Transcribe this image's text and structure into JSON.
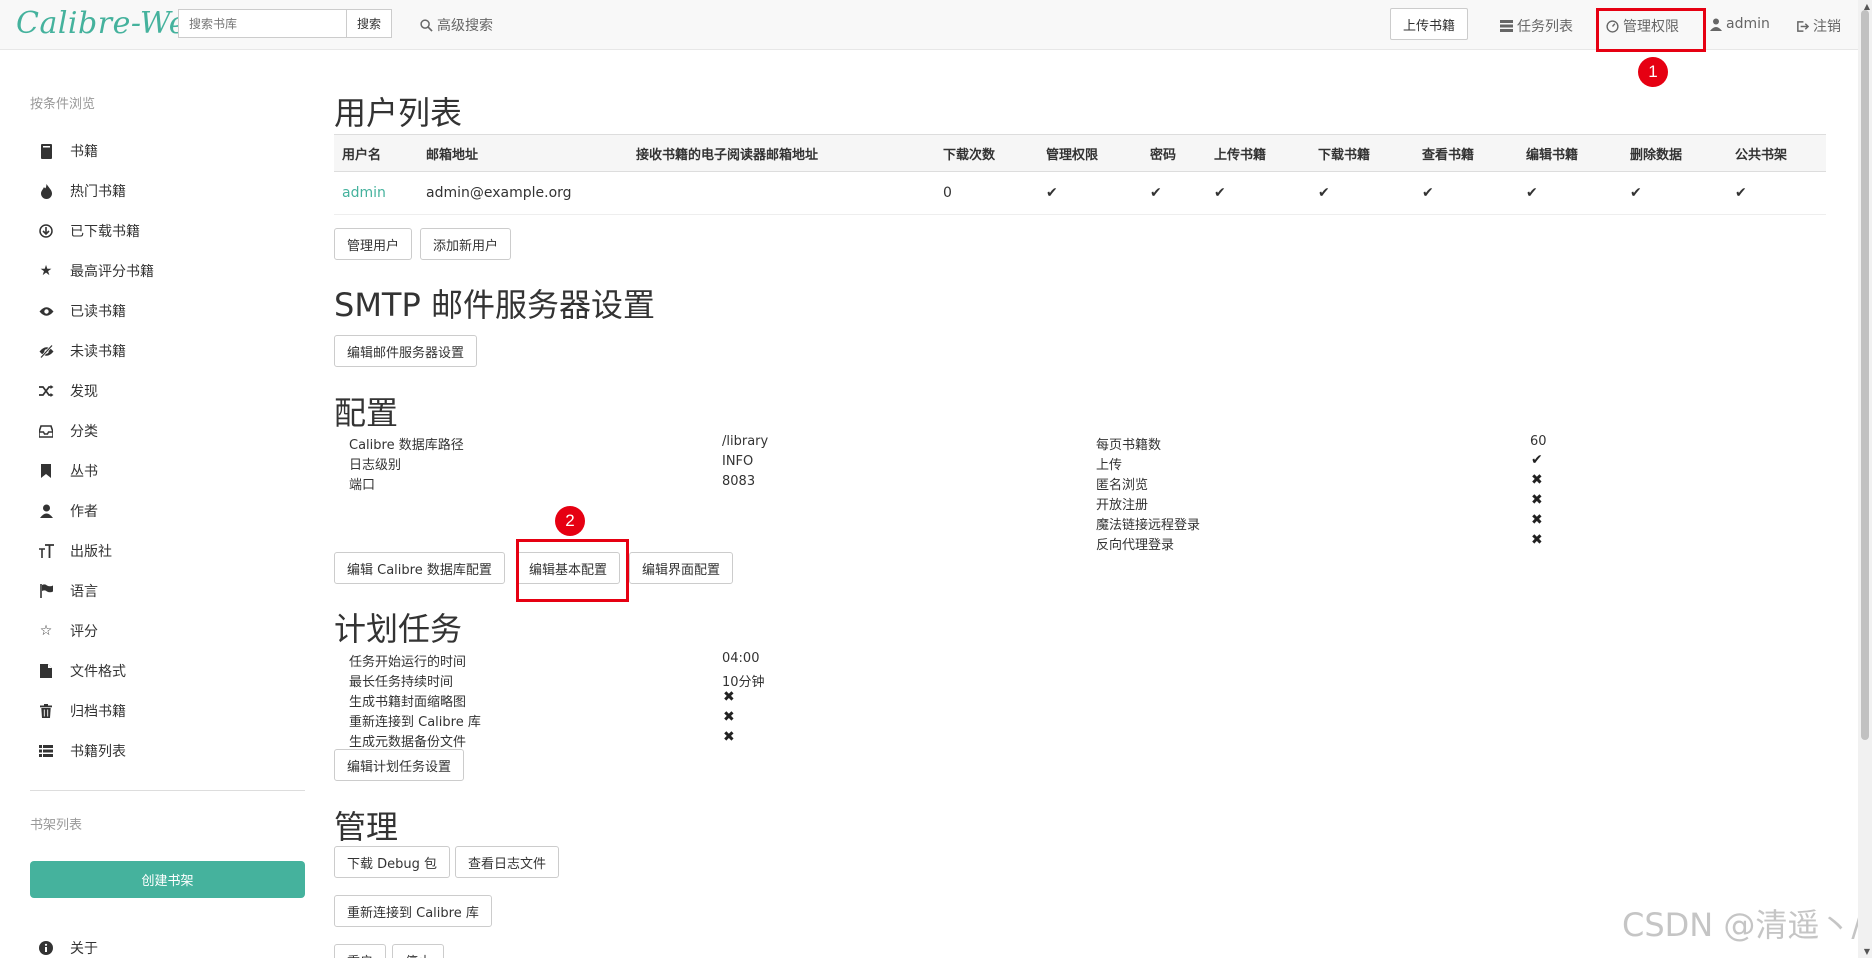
{
  "brand": "Calibre-Web",
  "search": {
    "placeholder": "搜索书库",
    "button": "搜索"
  },
  "nav": {
    "advanced_search": "高级搜索",
    "upload": "上传书籍",
    "tasks": "任务列表",
    "admin": "管理权限",
    "user": "admin",
    "logout": "注销"
  },
  "annotations": {
    "one": "1",
    "two": "2"
  },
  "sidebar": {
    "browse_header": "按条件浏览",
    "items": [
      {
        "label": "书籍",
        "icon": "book-icon"
      },
      {
        "label": "热门书籍",
        "icon": "fire-icon"
      },
      {
        "label": "已下载书籍",
        "icon": "download-icon"
      },
      {
        "label": "最高评分书籍",
        "icon": "star-icon"
      },
      {
        "label": "已读书籍",
        "icon": "eye-icon"
      },
      {
        "label": "未读书籍",
        "icon": "eye-slash-icon"
      },
      {
        "label": "发现",
        "icon": "shuffle-icon"
      },
      {
        "label": "分类",
        "icon": "inbox-icon"
      },
      {
        "label": "丛书",
        "icon": "bookmark-icon"
      },
      {
        "label": "作者",
        "icon": "user-icon"
      },
      {
        "label": "出版社",
        "icon": "text-size-icon"
      },
      {
        "label": "语言",
        "icon": "flag-icon"
      },
      {
        "label": "评分",
        "icon": "star-empty-icon"
      },
      {
        "label": "文件格式",
        "icon": "file-icon"
      },
      {
        "label": "归档书籍",
        "icon": "trash-icon"
      },
      {
        "label": "书籍列表",
        "icon": "list-icon"
      }
    ],
    "shelf_header": "书架列表",
    "create_shelf": "创建书架",
    "about": "关于"
  },
  "users": {
    "title": "用户列表",
    "columns": [
      "用户名",
      "邮箱地址",
      "接收书籍的电子阅读器邮箱地址",
      "下载次数",
      "管理权限",
      "密码",
      "上传书籍",
      "下载书籍",
      "查看书籍",
      "编辑书籍",
      "删除数据",
      "公共书架"
    ],
    "rows": [
      {
        "name": "admin",
        "email": "admin@example.org",
        "kindle": "",
        "downloads": "0",
        "admin": "✔",
        "password": "✔",
        "upload": "✔",
        "download": "✔",
        "view": "✔",
        "edit": "✔",
        "delete": "✔",
        "shelf": "✔"
      }
    ],
    "manage_btn": "管理用户",
    "add_btn": "添加新用户"
  },
  "smtp": {
    "title": "SMTP 邮件服务器设置",
    "edit_btn": "编辑邮件服务器设置"
  },
  "config": {
    "title": "配置",
    "left": [
      {
        "label": "Calibre 数据库路径",
        "value": "/library"
      },
      {
        "label": "日志级别",
        "value": "INFO"
      },
      {
        "label": "端口",
        "value": "8083"
      }
    ],
    "right": [
      {
        "label": "每页书籍数",
        "value": "60"
      },
      {
        "label": "上传",
        "value": "✔"
      },
      {
        "label": "匿名浏览",
        "value": "✖"
      },
      {
        "label": "开放注册",
        "value": "✖"
      },
      {
        "label": "魔法链接远程登录",
        "value": "✖"
      },
      {
        "label": "反向代理登录",
        "value": "✖"
      }
    ],
    "btn_db": "编辑 Calibre 数据库配置",
    "btn_basic": "编辑基本配置",
    "btn_ui": "编辑界面配置"
  },
  "schedule": {
    "title": "计划任务",
    "rows": [
      {
        "label": "任务开始运行的时间",
        "value": "04:00"
      },
      {
        "label": "最长任务持续时间",
        "value": "10分钟"
      },
      {
        "label": "生成书籍封面缩略图",
        "value": "✖"
      },
      {
        "label": "重新连接到 Calibre 库",
        "value": "✖"
      },
      {
        "label": "生成元数据备份文件",
        "value": "✖"
      }
    ],
    "edit_btn": "编辑计划任务设置"
  },
  "admin": {
    "title": "管理",
    "debug_btn": "下载 Debug 包",
    "log_btn": "查看日志文件",
    "reconnect_btn": "重新连接到 Calibre 库",
    "restart_btn": "重启",
    "stop_btn": "停止"
  },
  "watermark": "CSDN @清遥丶/"
}
